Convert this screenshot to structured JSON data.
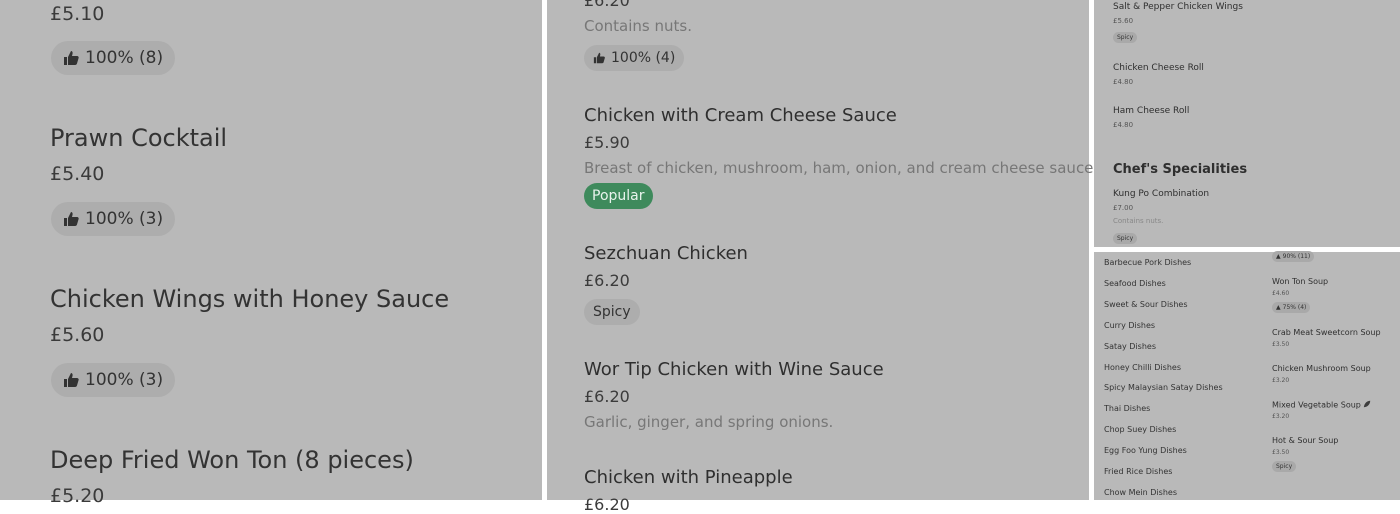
{
  "panel1": {
    "items": [
      {
        "name": "",
        "price": "£5.10",
        "rating": "100% (8)"
      },
      {
        "name": "Prawn Cocktail",
        "price": "£5.40",
        "rating": "100% (3)"
      },
      {
        "name": "Chicken Wings with Honey Sauce",
        "price": "£5.60",
        "rating": "100% (3)"
      },
      {
        "name": "Deep Fried Won Ton (8 pieces)",
        "price": "£5.20",
        "rating": ""
      }
    ]
  },
  "panel2": {
    "top_price": "£6.20",
    "top_desc": "Contains nuts.",
    "top_rating": "100% (4)",
    "items": [
      {
        "name": "Chicken with Cream Cheese Sauce",
        "price": "£5.90",
        "desc": "Breast of chicken, mushroom, ham, onion, and cream cheese sauce.",
        "badge": "Popular"
      },
      {
        "name": "Sezchuan Chicken",
        "price": "£6.20",
        "badge": "Spicy"
      },
      {
        "name": "Wor Tip Chicken with Wine Sauce",
        "price": "£6.20",
        "desc": "Garlic, ginger, and spring onions."
      },
      {
        "name": "Chicken with Pineapple",
        "price": "£6.20"
      }
    ]
  },
  "panel3": {
    "items": [
      {
        "name": "Salt & Pepper Chicken Wings",
        "price": "£5.60",
        "badge": "Spicy"
      },
      {
        "name": "Chicken Cheese Roll",
        "price": "£4.80"
      },
      {
        "name": "Ham Cheese Roll",
        "price": "£4.80"
      }
    ],
    "section_title": "Chef's Specialities",
    "special": {
      "name": "Kung Po Combination",
      "price": "£7.00",
      "desc": "Contains nuts.",
      "badge": "Spicy"
    }
  },
  "panel4": {
    "categories": [
      "Barbecue Pork Dishes",
      "Seafood Dishes",
      "Sweet & Sour Dishes",
      "Curry Dishes",
      "Satay Dishes",
      "Honey Chilli Dishes",
      "Spicy Malaysian Satay Dishes",
      "Thai Dishes",
      "Chop Suey Dishes",
      "Egg Foo Yung Dishes",
      "Fried Rice Dishes",
      "Chow Mein Dishes"
    ],
    "top_rating": "90% (11)",
    "soups": [
      {
        "name": "Won Ton Soup",
        "price": "£4.60",
        "rating": "75% (4)"
      },
      {
        "name": "Crab Meat Sweetcorn Soup",
        "price": "£3.50"
      },
      {
        "name": "Chicken Mushroom Soup",
        "price": "£3.20"
      },
      {
        "name": "Mixed Vegetable Soup",
        "price": "£3.20",
        "icon": "leaf-icon"
      },
      {
        "name": "Hot & Sour Soup",
        "price": "£3.50",
        "badge": "Spicy"
      }
    ]
  }
}
